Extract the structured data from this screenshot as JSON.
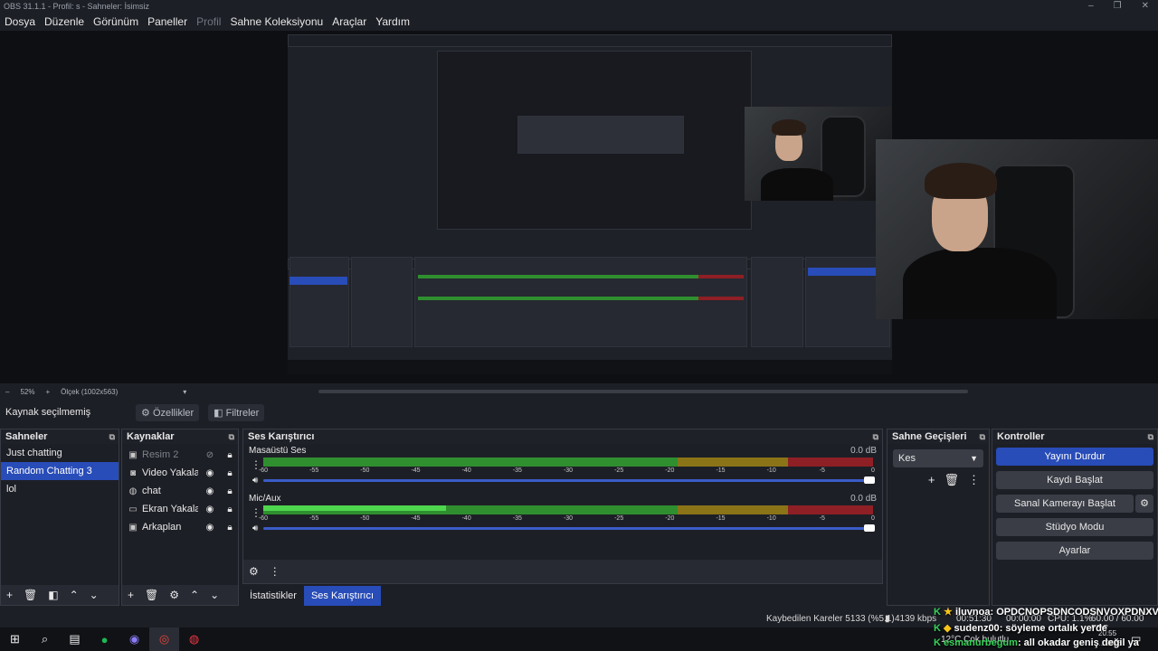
{
  "window": {
    "title": "OBS 31.1.1 - Profil: s - Sahneler: İsimsiz",
    "controls": [
      "–",
      "❐",
      "✕"
    ]
  },
  "menu": [
    "Dosya",
    "Düzenle",
    "Görünüm",
    "Paneller",
    "Profil",
    "Sahne Koleksiyonu",
    "Araçlar",
    "Yardım"
  ],
  "zoom": {
    "minus": "–",
    "level": "52%",
    "plus": "+",
    "scale": "Ölçek (1002x563)",
    "caret": "▾"
  },
  "properties_bar": {
    "source_status": "Kaynak seçilmemiş",
    "properties_label": "Özellikler",
    "filters_label": "Filtreler"
  },
  "scenes": {
    "title": "Sahneler",
    "items": [
      "Just chatting",
      "Random Chatting 3",
      "lol"
    ],
    "selected_index": 1
  },
  "sources": {
    "title": "Kaynaklar",
    "items": [
      {
        "name": "Resim 2",
        "icon": "image-icon",
        "visible": false
      },
      {
        "name": "Video Yakalama A",
        "icon": "camera-icon",
        "visible": true
      },
      {
        "name": "chat",
        "icon": "globe-icon",
        "visible": true
      },
      {
        "name": "Ekran Yakalama",
        "icon": "monitor-icon",
        "visible": true
      },
      {
        "name": "Arkaplan",
        "icon": "image-icon",
        "visible": true
      }
    ]
  },
  "mixer": {
    "title": "Ses Karıştırıcı",
    "ticks": [
      "-60",
      "-55",
      "-50",
      "-45",
      "-40",
      "-35",
      "-30",
      "-25",
      "-20",
      "-15",
      "-10",
      "-5",
      "0"
    ],
    "channels": [
      {
        "name": "Masaüstü Ses",
        "db": "0.0 dB",
        "level": 0
      },
      {
        "name": "Mic/Aux",
        "db": "0.0 dB",
        "level": 0.3
      }
    ]
  },
  "tabs": [
    "İstatistikler",
    "Ses Karıştırıcı"
  ],
  "transitions": {
    "title": "Sahne Geçişleri",
    "selected": "Kes"
  },
  "controls": {
    "title": "Kontroller",
    "stream": "Yayını Durdur",
    "record": "Kaydı Başlat",
    "virtual_cam": "Sanal Kamerayı Başlat",
    "studio": "Stüdyo Modu",
    "settings": "Ayarlar"
  },
  "status": {
    "dropped": "Kaybedilen Kareler 5133 (%5.1)",
    "bitrate": "4139 kbps",
    "time": "00:51:30",
    "rec_time": "00:00:00",
    "cpu": "CPU: 1.1%",
    "fps": "60.00 / 60.00 FPS"
  },
  "chat": [
    {
      "user": "iluvnoa",
      "text": ": OPDCNOPSDNCODSNVOXPDNXV"
    },
    {
      "user": "sudenz00",
      "text": ": söyleme ortalık yerde"
    },
    {
      "user": "esmanurbegum",
      "text": ": all okadar geniş değil ya"
    }
  ],
  "taskbar": {
    "weather": "12°C  Çok bulutlu",
    "clock": "20:55",
    "date": "…2026"
  },
  "colors": {
    "accent": "#284cb8",
    "meter_green": "#2f8f2f",
    "meter_yellow": "#8a7417",
    "meter_red": "#8e1f25",
    "bg": "#1d1f26"
  }
}
